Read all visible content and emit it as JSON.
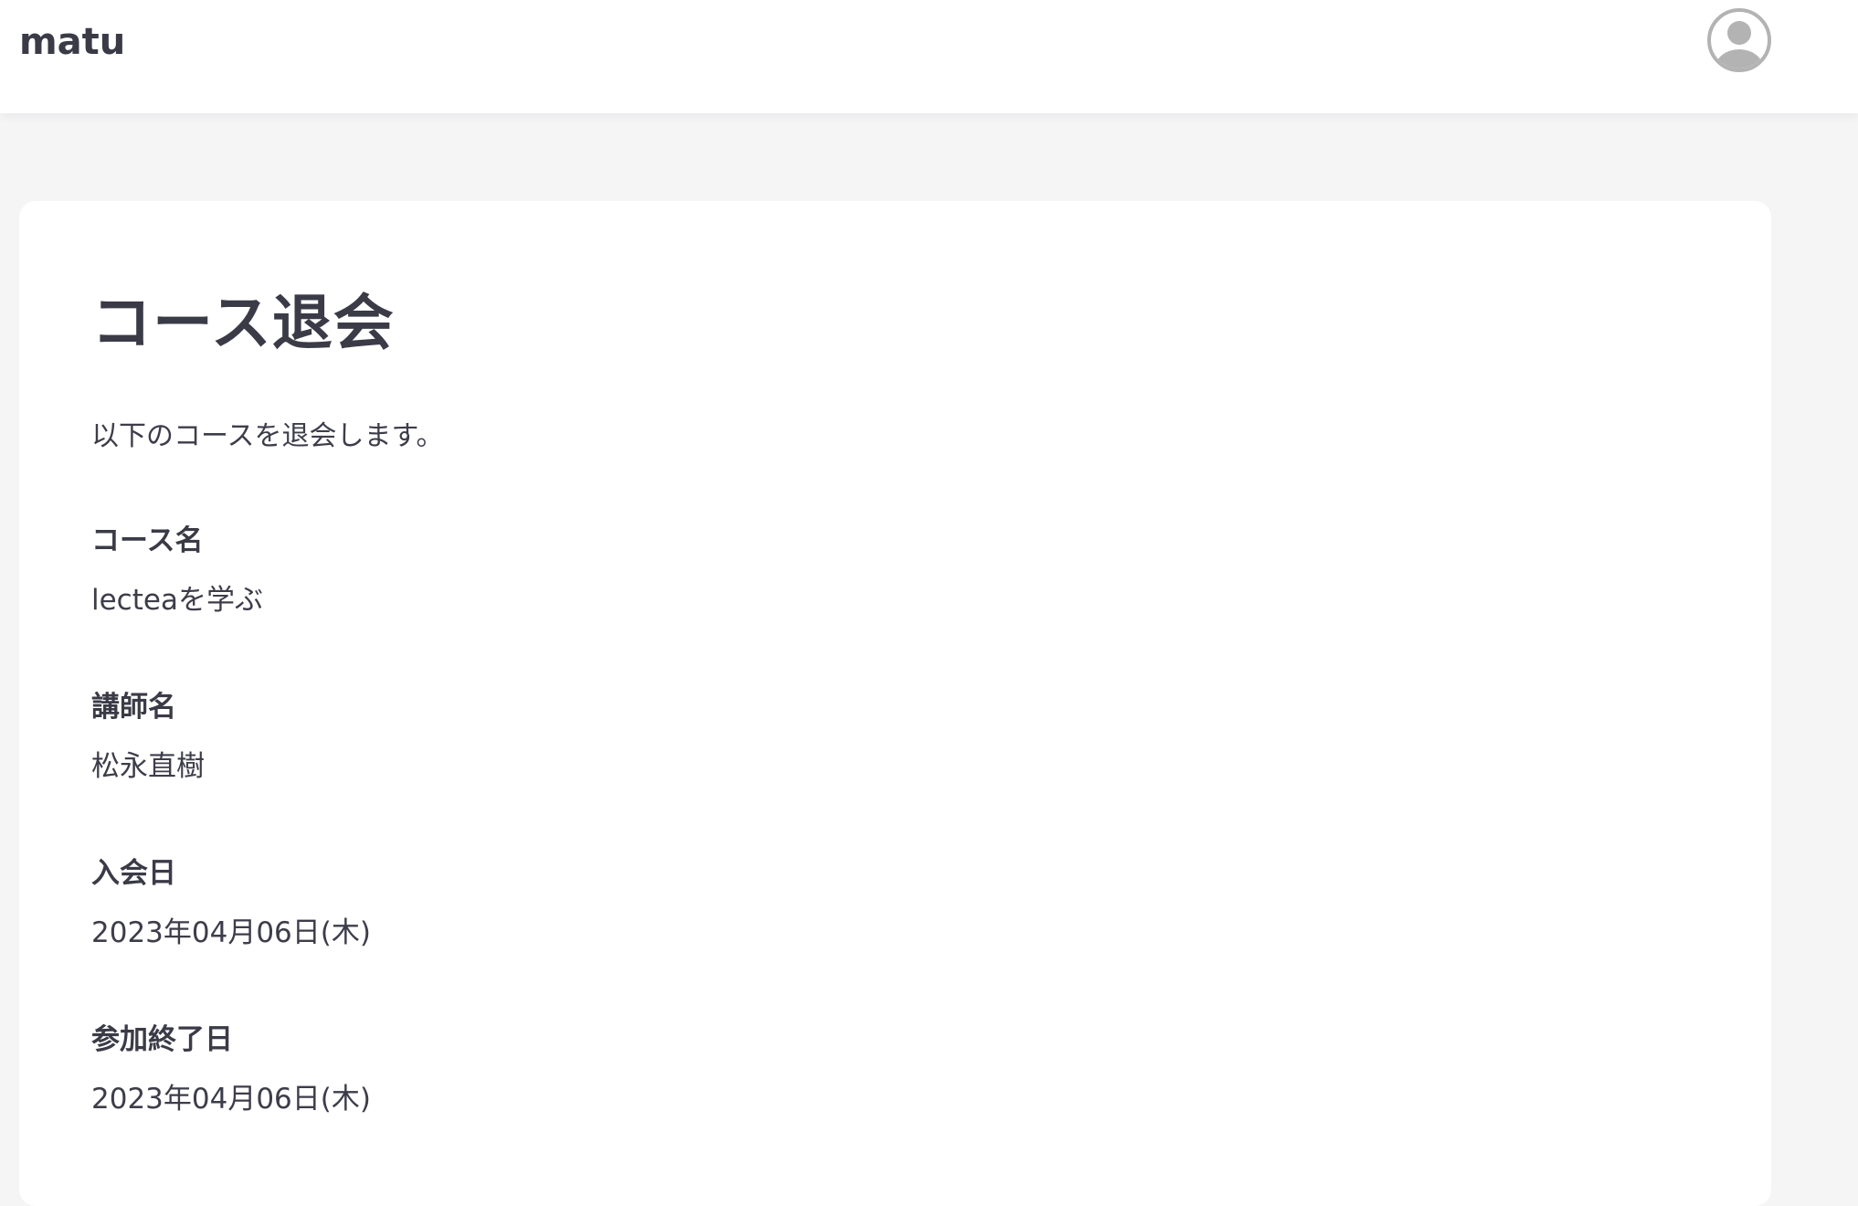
{
  "header": {
    "app_title": "matu",
    "avatar_icon": "user-avatar-icon"
  },
  "main": {
    "title": "コース退会",
    "intro": "以下のコースを退会します。",
    "fields": [
      {
        "label": "コース名",
        "value": "lecteaを学ぶ"
      },
      {
        "label": "講師名",
        "value": "松永直樹"
      },
      {
        "label": "入会日",
        "value": "2023年04月06日(木)"
      },
      {
        "label": "参加終了日",
        "value": "2023年04月06日(木)"
      }
    ]
  },
  "colors": {
    "page_background": "#f5f5f6",
    "card_background": "#ffffff",
    "text": "#3d3d4a",
    "avatar_gray": "#b3b3b3"
  }
}
